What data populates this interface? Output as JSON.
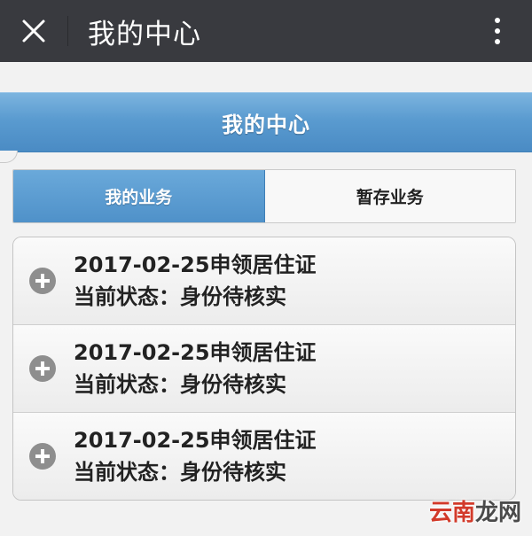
{
  "topbar": {
    "close_icon": "close-icon",
    "title": "我的中心",
    "more_icon": "more-vertical-icon"
  },
  "header": {
    "title": "我的中心"
  },
  "tabs": [
    {
      "label": "我的业务",
      "active": true
    },
    {
      "label": "暂存业务",
      "active": false
    }
  ],
  "items": [
    {
      "title": "2017-02-25申领居住证",
      "status": "当前状态：身份待核实",
      "icon": "plus-circle-icon"
    },
    {
      "title": "2017-02-25申领居住证",
      "status": "当前状态：身份待核实",
      "icon": "plus-circle-icon"
    },
    {
      "title": "2017-02-25申领居住证",
      "status": "当前状态：身份待核实",
      "icon": "plus-circle-icon"
    }
  ],
  "watermark": {
    "part1": "云南",
    "part2": "龙网"
  },
  "colors": {
    "topbar": "#393a3f",
    "accent": "#4f91c9",
    "background": "#f2f2f2"
  }
}
